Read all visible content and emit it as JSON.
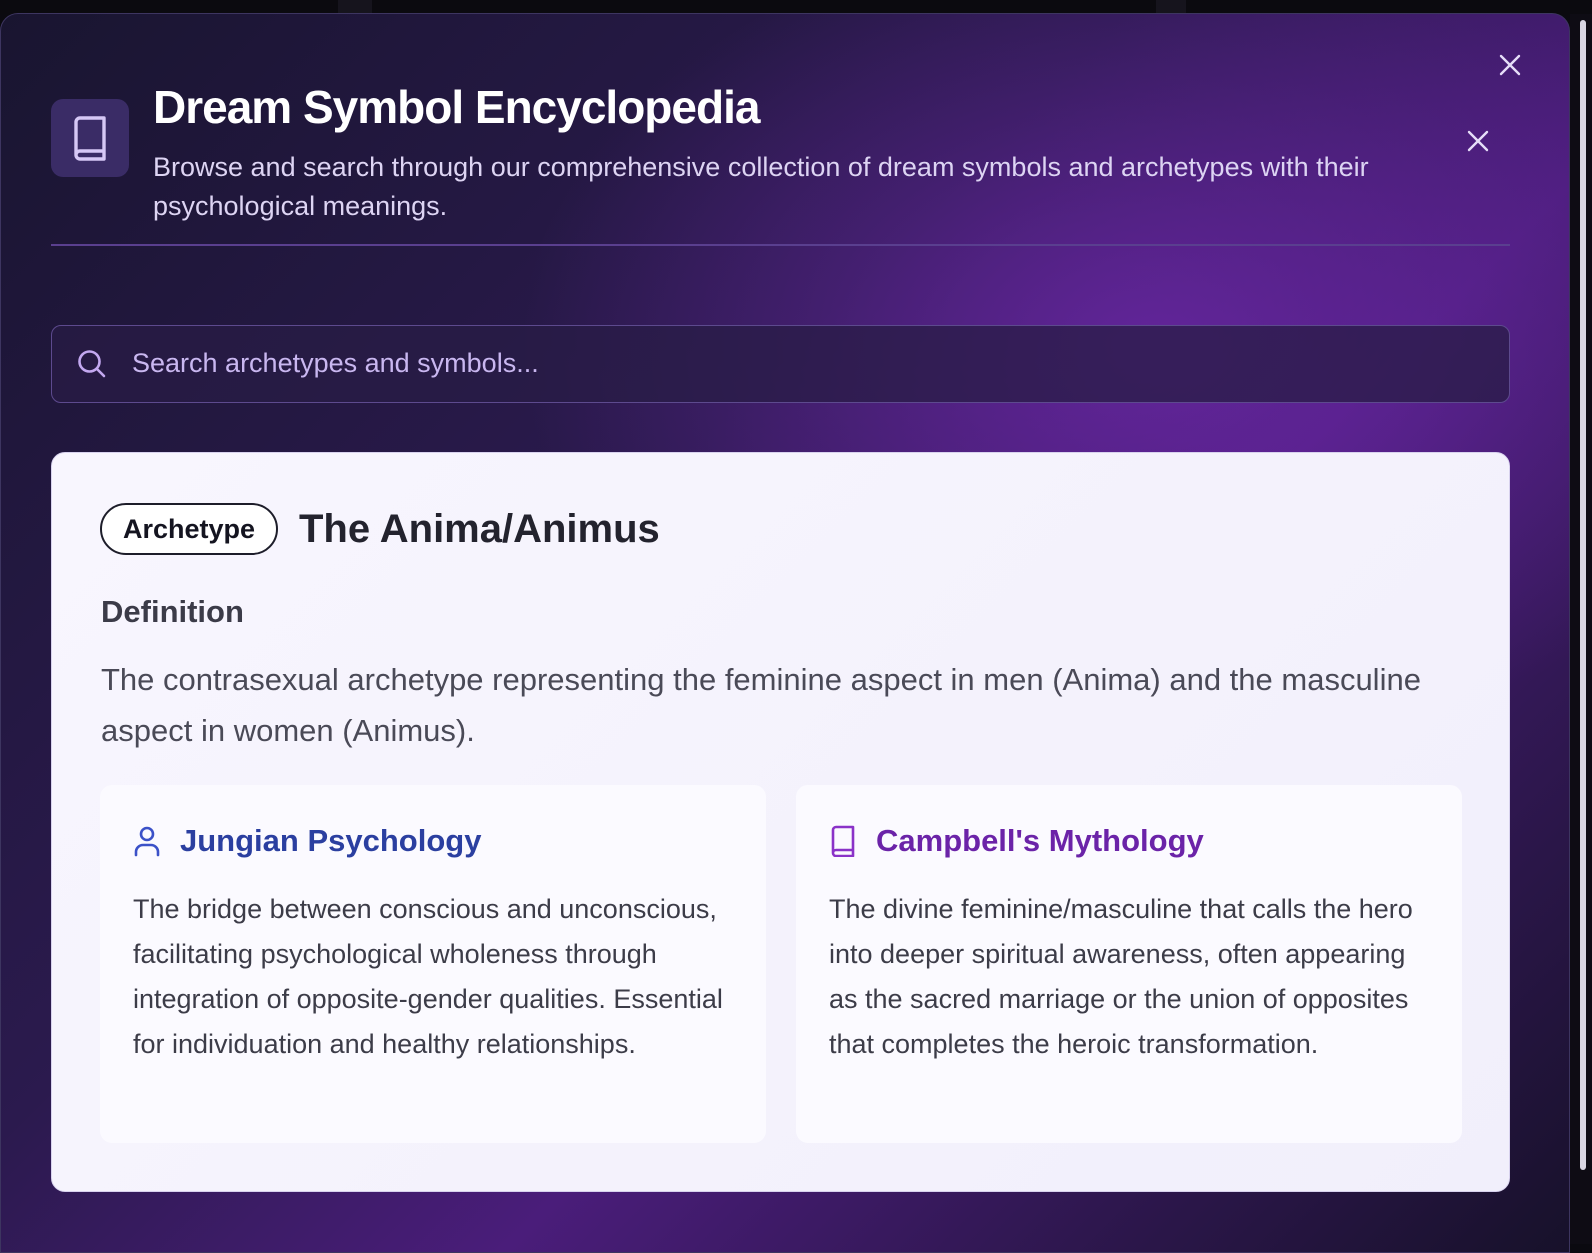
{
  "modal": {
    "title": "Dream Symbol Encyclopedia",
    "subtitle": "Browse and search through our comprehensive collection of dream symbols and archetypes with their psychological meanings.",
    "header_icon": "book-icon",
    "close_icons": [
      "close-icon",
      "close-icon"
    ]
  },
  "search": {
    "placeholder": "Search archetypes and symbols...",
    "value": "",
    "icon": "search-icon"
  },
  "entry": {
    "badge": "Archetype",
    "title": "The Anima/Animus",
    "definition_heading": "Definition",
    "definition": "The contrasexual archetype representing the feminine aspect in men (Anima) and the masculine aspect in women (Animus).",
    "perspectives": [
      {
        "icon": "user-icon",
        "title": "Jungian Psychology",
        "text": "The bridge between conscious and unconscious, facilitating psychological wholeness through integration of opposite-gender qualities. Essential for individuation and healthy relationships.",
        "color": "#2b3fa0"
      },
      {
        "icon": "book-icon",
        "title": "Campbell's Mythology",
        "text": "The divine feminine/masculine that calls the hero into deeper spiritual awareness, often appearing as the sacred marriage or the union of opposites that completes the heroic transformation.",
        "color": "#6b23a8"
      }
    ]
  },
  "colors": {
    "modal_gradient_start": "#191530",
    "modal_gradient_mid": "#4a1d7a",
    "card_background": "#f8f6fe",
    "accent_purple": "#6b23a8",
    "accent_blue": "#2b3fa0"
  }
}
